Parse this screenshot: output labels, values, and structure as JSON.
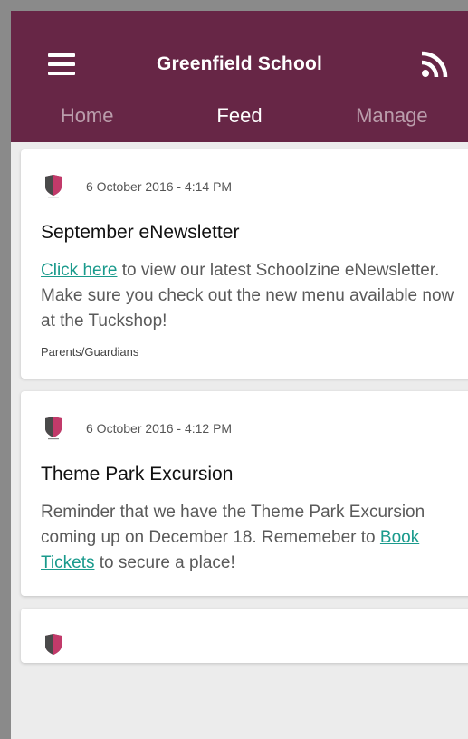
{
  "app": {
    "title": "Greenfield School"
  },
  "tabs": [
    {
      "label": "Home",
      "active": false
    },
    {
      "label": "Feed",
      "active": true
    },
    {
      "label": "Manage",
      "active": false
    }
  ],
  "colors": {
    "brand": "#672646",
    "link": "#1a9a8c"
  },
  "icons": {
    "menu": "hamburger-menu-icon",
    "rss": "rss-feed-icon",
    "school_logo": "school-shield-icon"
  },
  "posts": [
    {
      "date": "6 October 2016 - 4:14 PM",
      "title": "September eNewsletter",
      "body_link": "Click here",
      "body_after": " to view our latest Schoolzine eNewsletter. Make sure you check out the new menu available now at the Tuckshop!",
      "audience": "Parents/Guardians"
    },
    {
      "date": "6 October 2016 - 4:12 PM",
      "title": "Theme Park Excursion",
      "body_before": "Reminder that we have the Theme Park Excursion coming up on December 18. Rememeber to ",
      "body_link": "Book Tickets",
      "body_after": " to secure a place!"
    }
  ]
}
